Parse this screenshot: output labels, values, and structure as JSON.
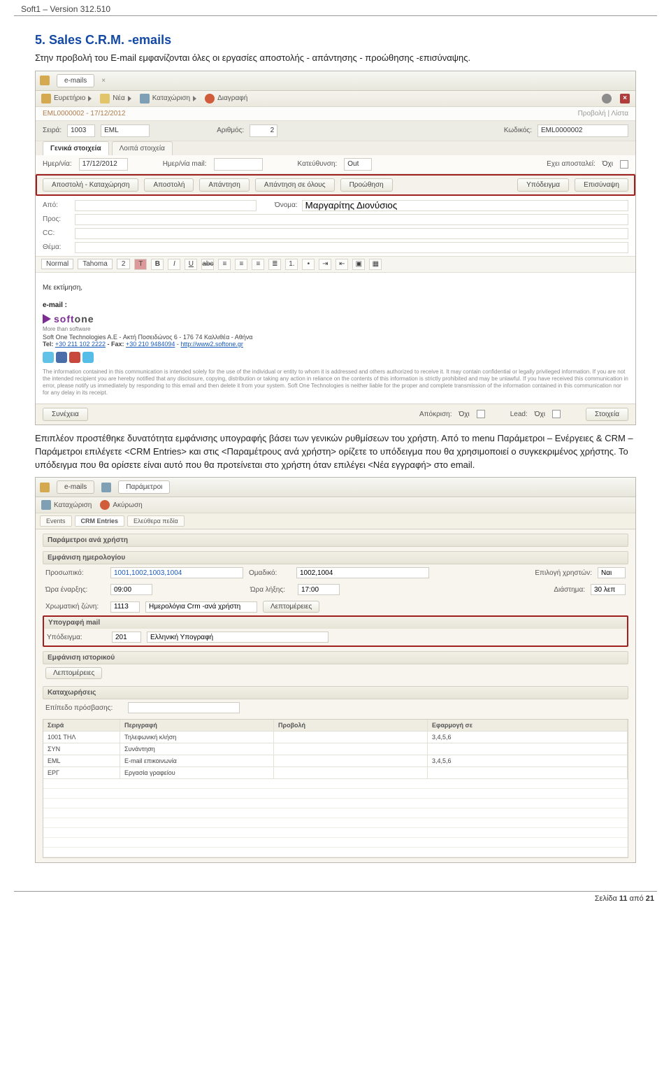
{
  "doc_header": "Soft1 – Version 312.510",
  "section_title": "5.  Sales C.R.M. -emails",
  "para1": "Στην προβολή του E-mail  εμφανίζονται όλες οι εργασίες αποστολής - απάντησης - προώθησης -επισύναψης.",
  "para2": "Επιπλέον προστέθηκε δυνατότητα εμφάνισης υπογραφής βάσει των γενικών ρυθμίσεων του χρήστη. Από το menu Παράμετροι – Ενέργειες & CRM –Παράμετροι επιλέγετε <CRM Entries> και στις <Παραμέτρους ανά χρήστη> ορίζετε το υπόδειγμα που θα χρησιμοποιεί ο συγκεκριμένος χρήστης. Το υπόδειγμα που θα ορίσετε είναι αυτό που θα προτείνεται στο χρήστη όταν επιλέγει <Νέα εγγραφή> στο email.",
  "shot1": {
    "tab_emails": "e-mails",
    "toolbar": {
      "evretirio": "Ευρετήριο",
      "nea": "Νέα",
      "kataxorisi": "Καταχώριση",
      "diagrafi": "Διαγραφή"
    },
    "crumb_left": "EML0000002 - 17/12/2012",
    "crumb_right": "Προβολή | Λίστα",
    "row1": {
      "seira_lbl": "Σειρά:",
      "seira_code": "1003",
      "seira_name": "EML",
      "arithmos_lbl": "Αριθμός:",
      "arithmos_val": "2",
      "kodikos_lbl": "Κωδικός:",
      "kodikos_val": "EML0000002"
    },
    "subtabs": {
      "a": "Γενικά στοιχεία",
      "b": "Λοιπά στοιχεία"
    },
    "row2": {
      "date_lbl": "Ημερ/νία:",
      "date_val": "17/12/2012",
      "maildate_lbl": "Ημερ/νία mail:",
      "dir_lbl": "Κατεύθυνση:",
      "dir_val": "Out",
      "sent_lbl": "Εχει αποσταλεί:",
      "sent_val": "Όχι"
    },
    "buttons": {
      "b1": "Αποστολή - Καταχώρηση",
      "b2": "Αποστολή",
      "b3": "Απάντηση",
      "b4": "Απάντηση σε όλους",
      "b5": "Προώθηση",
      "b6": "Υπόδειγμα",
      "b7": "Επισύναψη"
    },
    "form": {
      "from_lbl": "Από:",
      "name_lbl": "Όνομα:",
      "name_val": "Μαργαρίτης Διονύσιος",
      "to_lbl": "Προς:",
      "cc_lbl": "CC:",
      "subject_lbl": "Θέμα:"
    },
    "editor_tb": {
      "style": "Normal",
      "font": "Tahoma",
      "size": "2"
    },
    "sig": {
      "greeting": "Με εκτίμηση,",
      "email_lbl": "e-mail :",
      "brand": "softone",
      "tag": "More than software",
      "company_line": "Soft One Technologies A.E - Ακτή Ποσειδώνος 6 - 176 74 Καλλιθέα - Αθήνα",
      "tel_prefix": "Tel: ",
      "tel": "+30 211 102 2222",
      "fax_prefix": "- Fax: ",
      "fax": "+30 210 9484094",
      "url_prefix": "- ",
      "url": "http://www2.softone.gr",
      "disclaimer": "The information contained in this communication is intended solely for the use of the individual or entity to whom it is addressed and others authorized to receive it. It may contain confidential or legally privileged information. If you are not the intended recipient you are hereby notified that any disclosure, copying, distribution or taking any action in reliance on the contents of this information is strictly prohibited and may be unlawful. If you have received this communication in error, please notify us immediately by responding to this email and then delete it from your system. Soft One Technologies is neither liable for the proper and complete transmission of the information contained in this communication nor for any delay in its receipt."
    },
    "footer": {
      "synexeia": "Συνέχεια",
      "apokrisi_lbl": "Απόκριση:",
      "no": "Όχι",
      "lead_lbl": "Lead:",
      "stoixeia": "Στοιχεία"
    }
  },
  "shot2": {
    "top": {
      "t1": "e-mails",
      "t2": "Παράμετροι"
    },
    "tb": {
      "kat": "Καταχώριση",
      "aky": "Ακύρωση"
    },
    "tabs": {
      "a": "Events",
      "b": "CRM Entries",
      "c": "Ελεύθερα πεδία"
    },
    "sec_user": "Παράμετροι ανά χρήστη",
    "sec_cal": "Εμφάνιση ημερολογίου",
    "cal": {
      "pros_lbl": "Προσωπικό:",
      "pros_val": "1001,1002,1003,1004",
      "omad_lbl": "Ομαδικό:",
      "omad_val": "1002,1004",
      "epil_lbl": "Επιλογή χρηστών:",
      "epil_val": "Ναι",
      "ora_en_lbl": "Ώρα έναρξης:",
      "ora_en_val": "09:00",
      "ora_lx_lbl": "Ώρα λήξης:",
      "ora_lx_val": "17:00",
      "diast_lbl": "Διάστημα:",
      "diast_val": "30 λεπ",
      "zone_lbl": "Χρωματική ζώνη:",
      "zone_code": "1113",
      "zone_name": "Ημερολόγια Crm -ανά χρήστη",
      "lepto": "Λεπτομέρειες"
    },
    "sec_sig": "Υπογραφή mail",
    "sig_row": {
      "lbl": "Υπόδειγμα:",
      "code": "201",
      "name": "Ελληνική Υπογραφή"
    },
    "sec_hist": "Εμφάνιση ιστορικού",
    "hist_lepto": "Λεπτομέρειες",
    "sec_kat": "Καταχωρήσεις",
    "access_lbl": "Επίπεδο πρόσβασης:",
    "table": {
      "h1": "Σειρά",
      "h2": "Περιγραφή",
      "h3": "Προβολή",
      "h4": "Εφαρμογή σε",
      "rows": [
        {
          "c1": "1001  ΤΗΛ",
          "c2": "Τηλεφωνική κλήση",
          "c3": "",
          "c4": "3,4,5,6"
        },
        {
          "c1": "ΣΥΝ",
          "c2": "Συνάντηση",
          "c3": "",
          "c4": ""
        },
        {
          "c1": "EML",
          "c2": "E-mail επικοινωνία",
          "c3": "",
          "c4": "3,4,5,6"
        },
        {
          "c1": "ΕΡΓ",
          "c2": "Εργασία γραφείου",
          "c3": "",
          "c4": ""
        }
      ]
    }
  },
  "footer": {
    "prefix": "Σελίδα ",
    "num": "11",
    "mid": " από ",
    "total": "21"
  }
}
